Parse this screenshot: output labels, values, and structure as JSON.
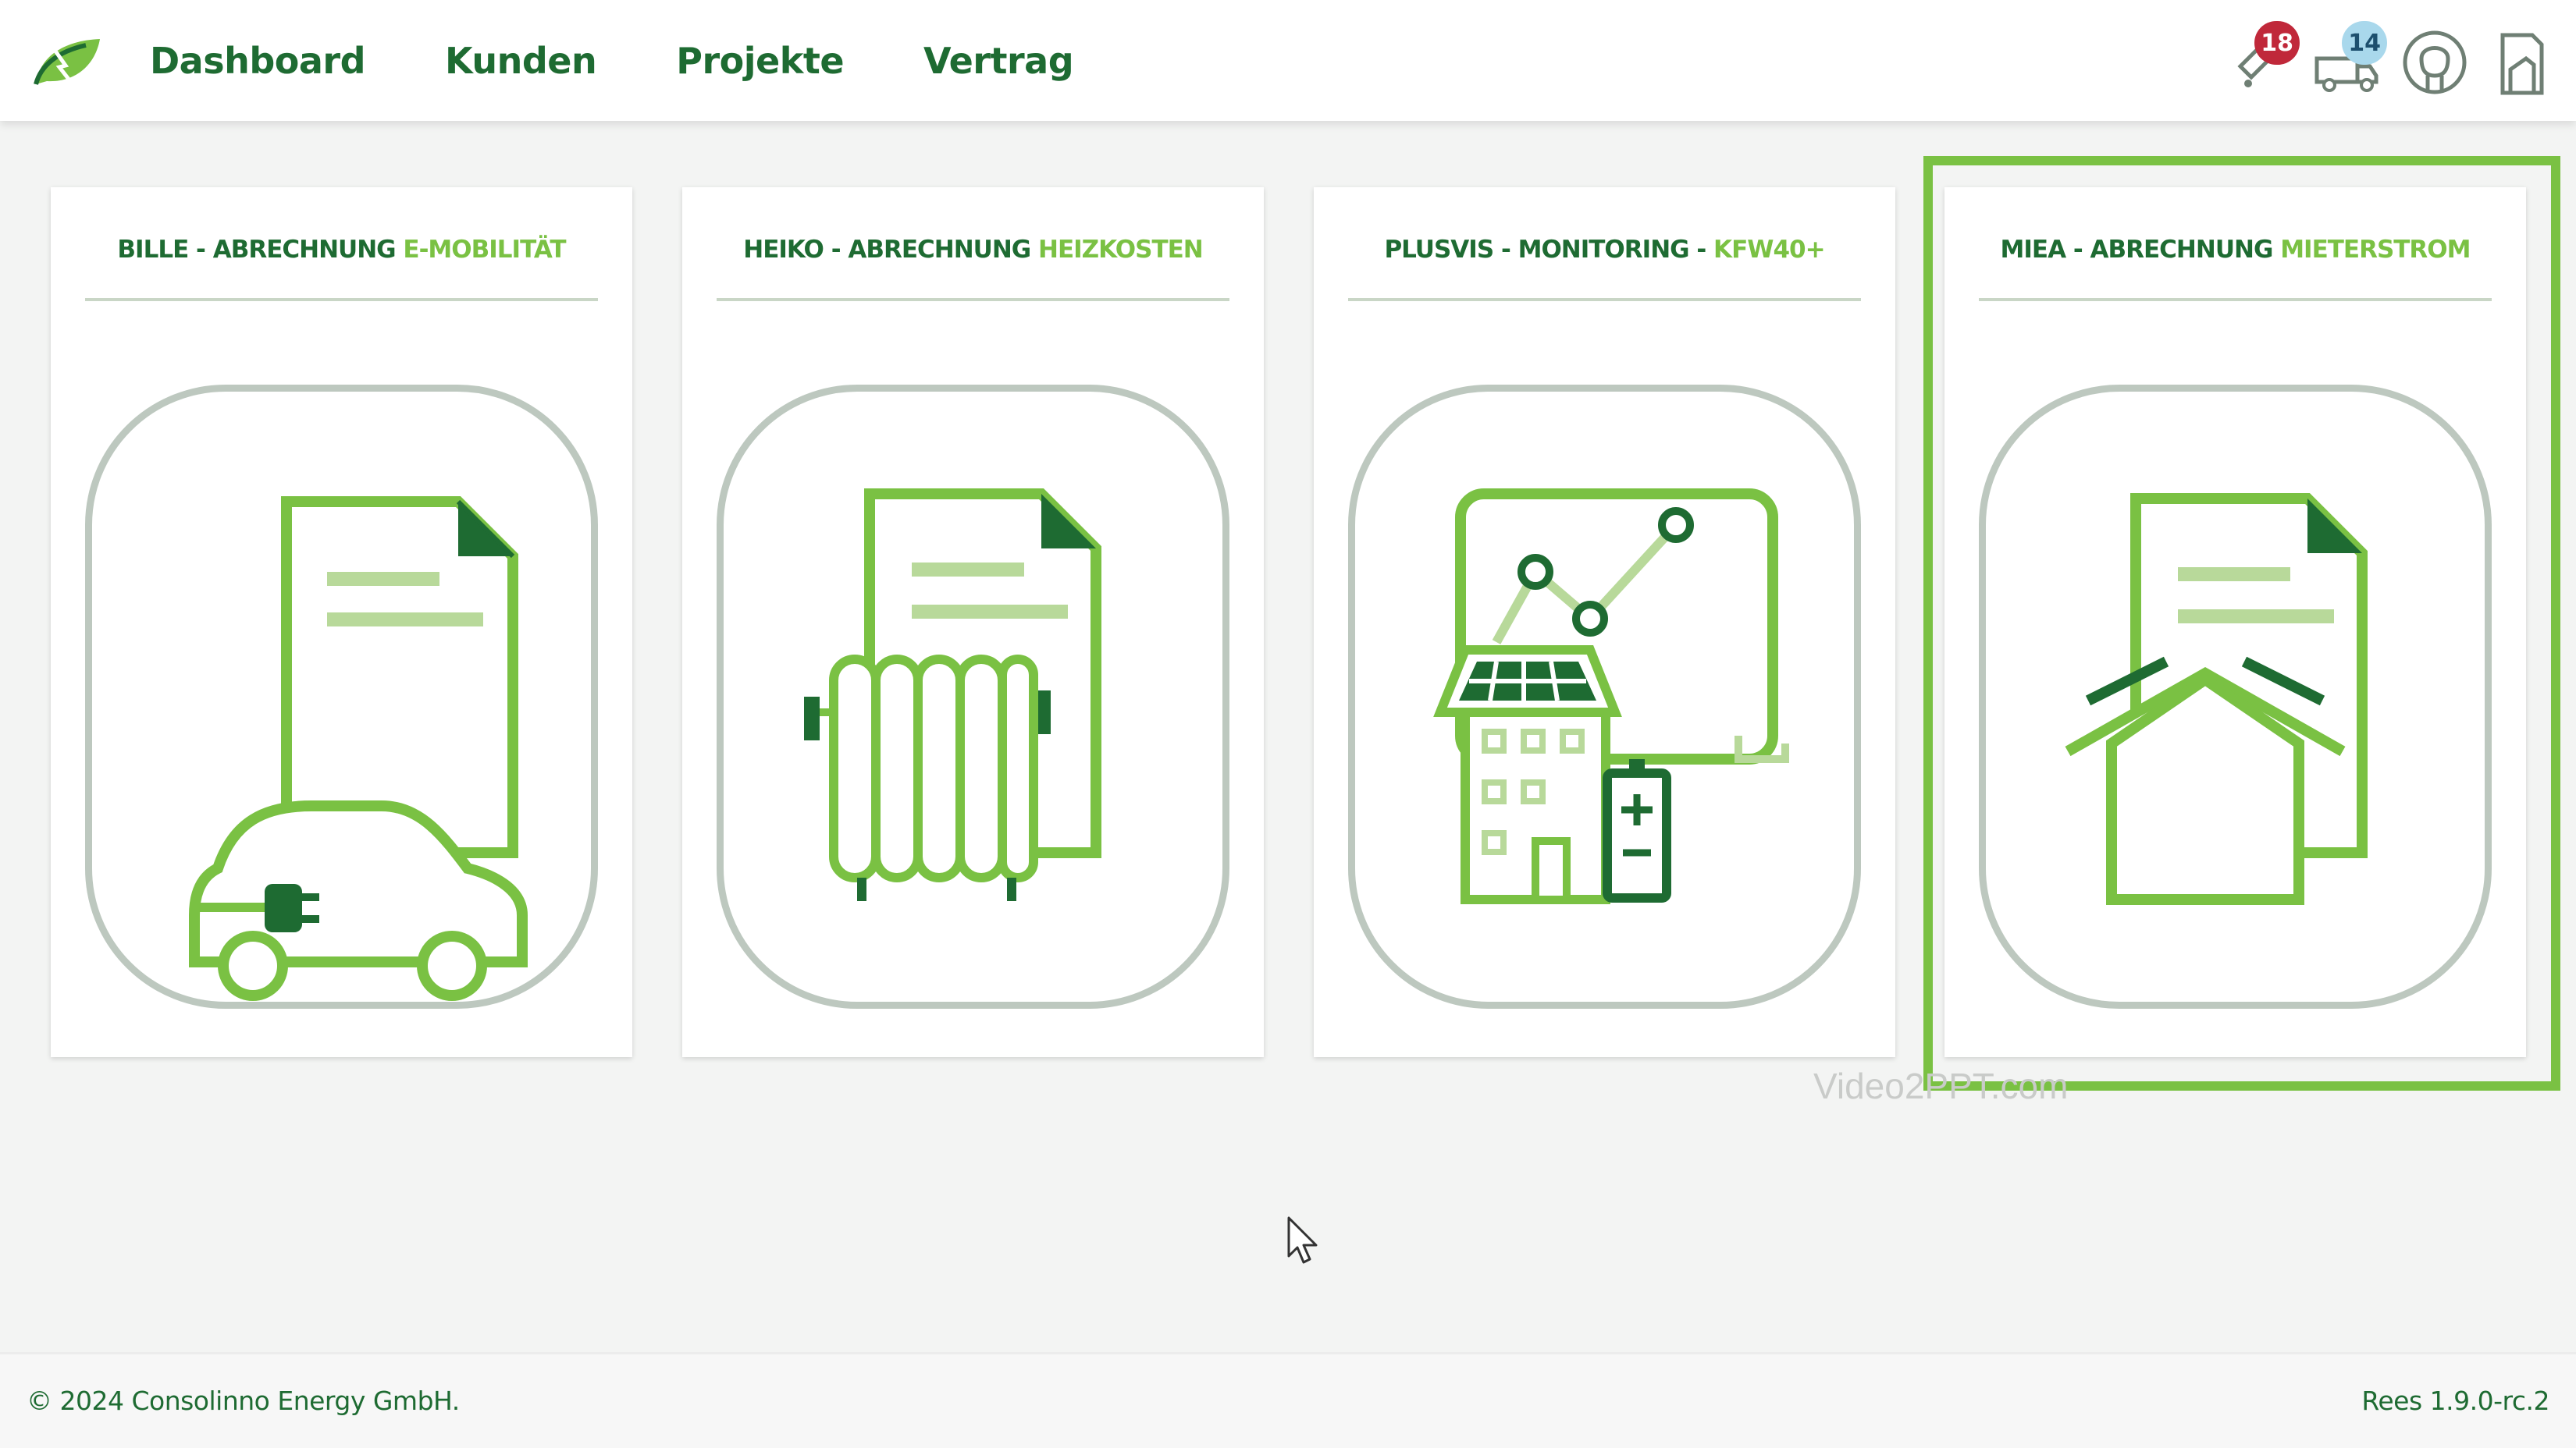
{
  "nav": {
    "items": [
      "Dashboard",
      "Kunden",
      "Projekte",
      "Vertrag"
    ]
  },
  "header": {
    "notifications_count": "18",
    "messages_count": "14",
    "icons": [
      "logo-leaf-icon",
      "notification-tag-icon",
      "truck-messages-icon",
      "user-profile-icon",
      "building-report-icon"
    ]
  },
  "cards": [
    {
      "title_main": "BILLE - ABRECHNUNG ",
      "title_accent": "E-MOBILITÄT",
      "icon": "electric-car-document-icon"
    },
    {
      "title_main": "HEIKO - ABRECHNUNG ",
      "title_accent": "HEIZKOSTEN",
      "icon": "radiator-document-icon"
    },
    {
      "title_main": "PLUSVIS - MONITORING - ",
      "title_accent": "KFW40+",
      "icon": "solar-building-monitoring-icon"
    },
    {
      "title_main": "MIEA - ABRECHNUNG ",
      "title_accent": "MIETERSTROM",
      "icon": "house-document-icon"
    }
  ],
  "watermark": "Video2PPT.com",
  "footer": {
    "copyright": "© 2024 Consolinno Energy GmbH.",
    "version": "Rees 1.9.0-rc.2"
  },
  "colors": {
    "primary_dark": "#1e6b32",
    "accent": "#7ac143",
    "topline": "#4a9ed6",
    "badge_red": "#c0283a",
    "badge_blue": "#a9d8ec"
  }
}
